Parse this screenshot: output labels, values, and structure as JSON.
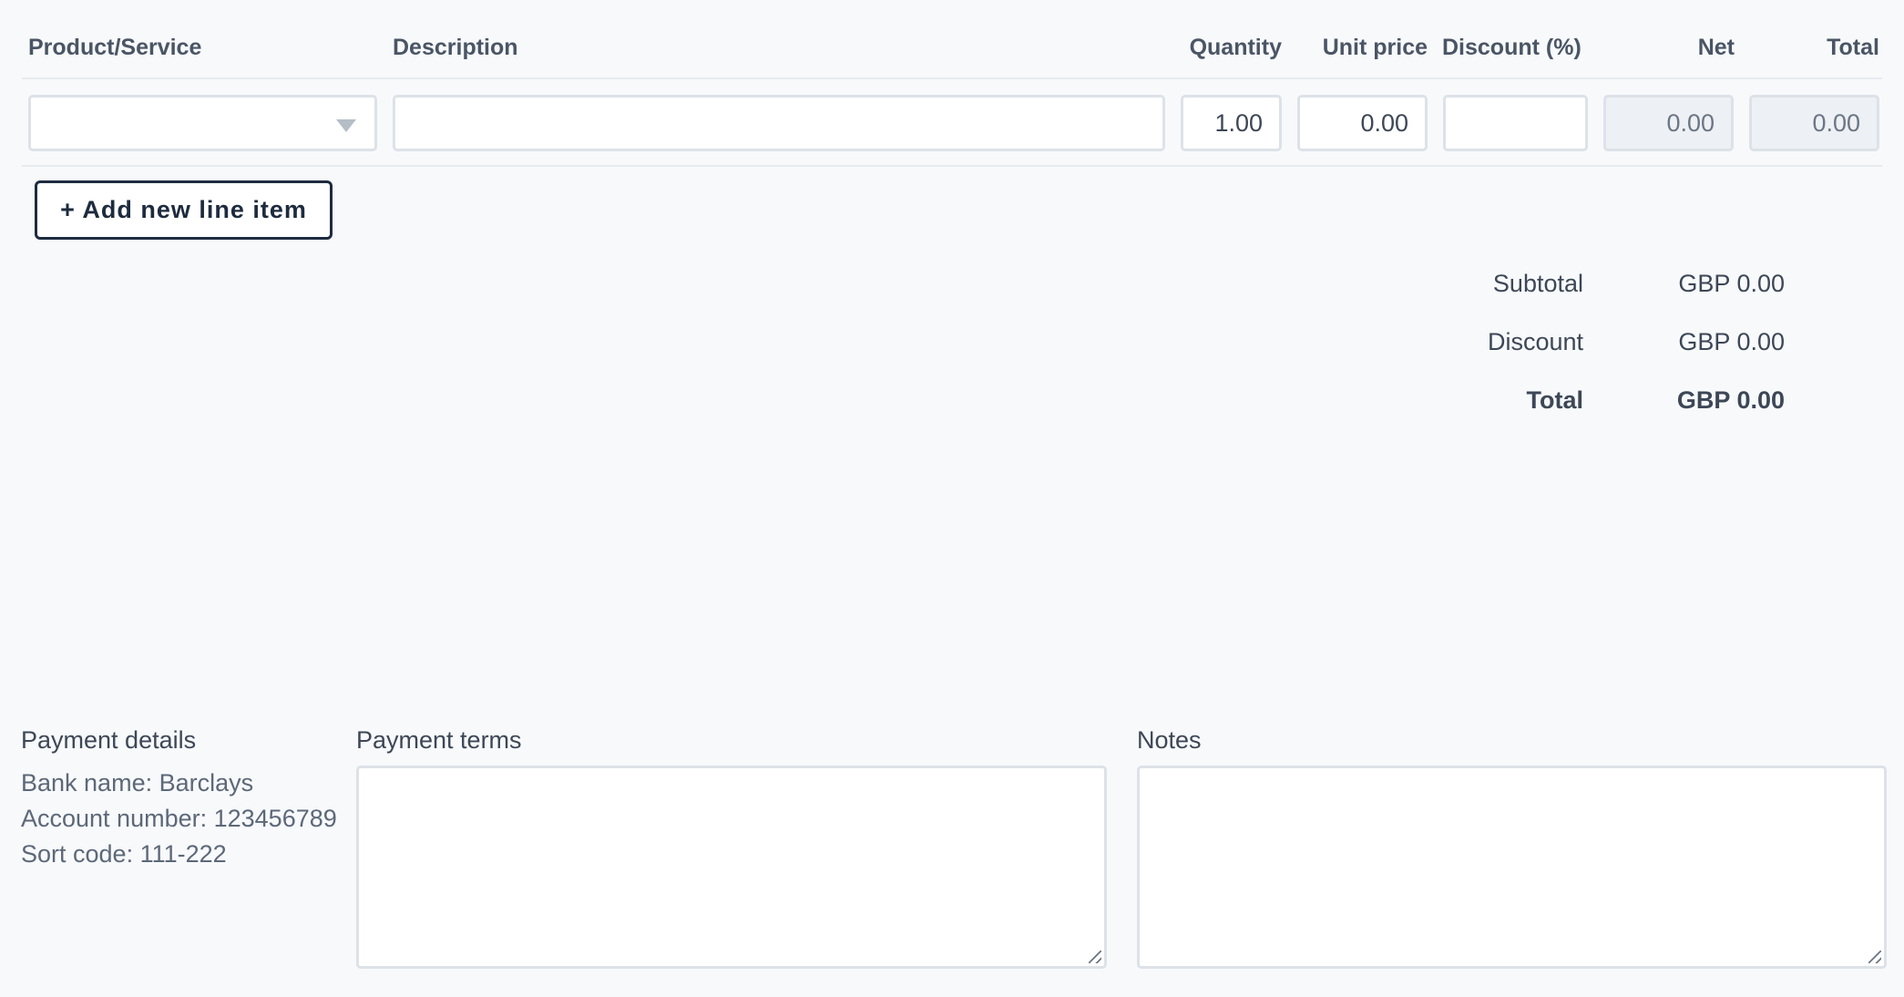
{
  "line_items": {
    "headers": {
      "product": "Product/Service",
      "description": "Description",
      "quantity": "Quantity",
      "unit_price": "Unit price",
      "discount": "Discount (%)",
      "net": "Net",
      "total": "Total"
    },
    "row": {
      "product": "",
      "description": "",
      "quantity": "1.00",
      "unit_price": "0.00",
      "discount": "",
      "net": "0.00",
      "total": "0.00"
    },
    "add_button_label": "+ Add new line item"
  },
  "totals": {
    "subtotal_label": "Subtotal",
    "subtotal_value": "GBP 0.00",
    "discount_label": "Discount",
    "discount_value": "GBP 0.00",
    "total_label": "Total",
    "total_value": "GBP 0.00"
  },
  "payment_details": {
    "label": "Payment details",
    "bank_name": "Bank name: Barclays",
    "account_number": "Account number: 123456789",
    "sort_code": "Sort code: 111-222"
  },
  "payment_terms": {
    "label": "Payment terms",
    "value": ""
  },
  "notes": {
    "label": "Notes",
    "value": ""
  },
  "icons": {
    "select_caret": "chevron-down-icon",
    "resize_grip": "resize-grip-icon"
  }
}
